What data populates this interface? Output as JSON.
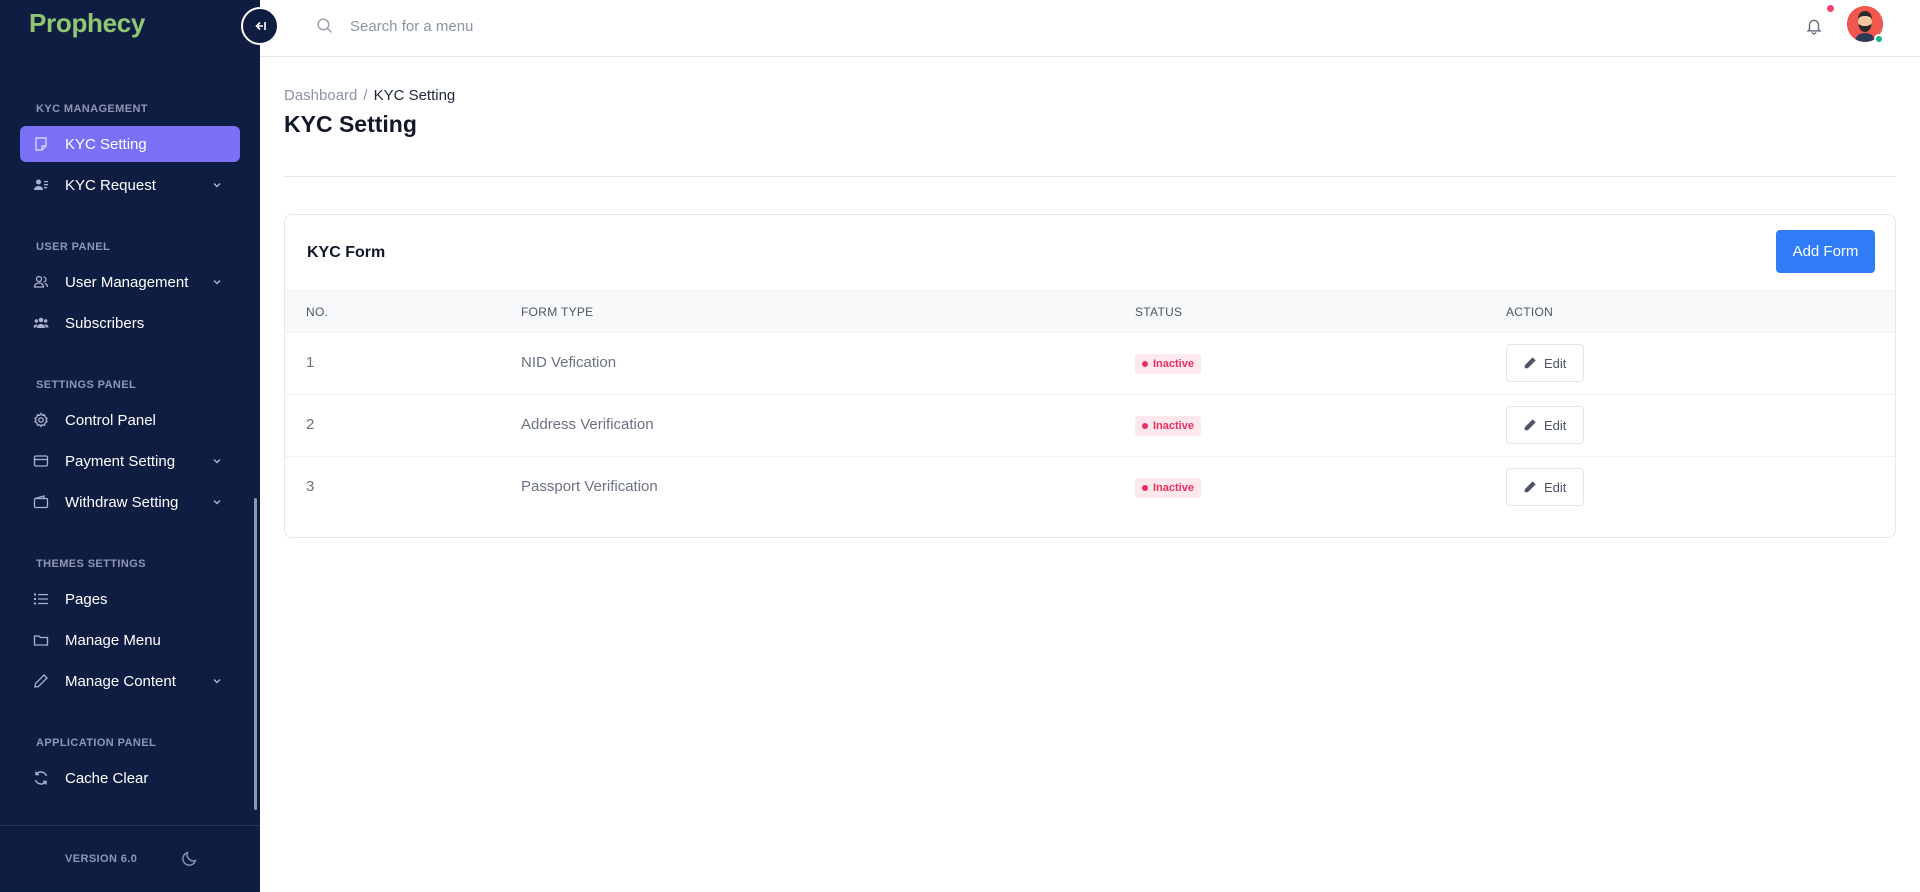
{
  "brand": {
    "name": "Prophecy",
    "color": "#8fc773"
  },
  "sidebar": {
    "sections": [
      {
        "title": "KYC MANAGEMENT"
      },
      {
        "title": "USER PANEL"
      },
      {
        "title": "SETTINGS PANEL"
      },
      {
        "title": "THEMES SETTINGS"
      },
      {
        "title": "APPLICATION PANEL"
      }
    ],
    "items": [
      {
        "label": "KYC Setting",
        "icon": "form-icon",
        "active": true,
        "has_submenu": false
      },
      {
        "label": "KYC Request",
        "icon": "user-list-icon",
        "active": false,
        "has_submenu": true
      },
      {
        "label": "User Management",
        "icon": "users-icon",
        "active": false,
        "has_submenu": true
      },
      {
        "label": "Subscribers",
        "icon": "group-icon",
        "active": false,
        "has_submenu": false
      },
      {
        "label": "Control Panel",
        "icon": "gear-icon",
        "active": false,
        "has_submenu": false
      },
      {
        "label": "Payment Setting",
        "icon": "card-icon",
        "active": false,
        "has_submenu": true
      },
      {
        "label": "Withdraw Setting",
        "icon": "wallet-icon",
        "active": false,
        "has_submenu": true
      },
      {
        "label": "Pages",
        "icon": "list-icon",
        "active": false,
        "has_submenu": false
      },
      {
        "label": "Manage Menu",
        "icon": "folder-icon",
        "active": false,
        "has_submenu": false
      },
      {
        "label": "Manage Content",
        "icon": "pencil-icon",
        "active": false,
        "has_submenu": true
      },
      {
        "label": "Cache Clear",
        "icon": "refresh-icon",
        "active": false,
        "has_submenu": false
      }
    ],
    "version": "VERSION 6.0",
    "active_color": "#7a6ff5",
    "background_color": "#101d42"
  },
  "header": {
    "search_placeholder": "Search for a menu",
    "notification_indicator": true
  },
  "breadcrumb": {
    "root": "Dashboard",
    "separator": "/",
    "current": "KYC Setting"
  },
  "page": {
    "title": "KYC Setting"
  },
  "card": {
    "title": "KYC Form",
    "add_button": "Add Form",
    "columns": [
      "NO.",
      "FORM TYPE",
      "STATUS",
      "ACTION"
    ],
    "rows": [
      {
        "no": "1",
        "form_type": "NID Vefication",
        "status": "Inactive",
        "action": "Edit"
      },
      {
        "no": "2",
        "form_type": "Address Verification",
        "status": "Inactive",
        "action": "Edit"
      },
      {
        "no": "3",
        "form_type": "Passport Verification",
        "status": "Inactive",
        "action": "Edit"
      }
    ],
    "status_color": "#e8305f",
    "button_color": "#2f7cf6"
  }
}
